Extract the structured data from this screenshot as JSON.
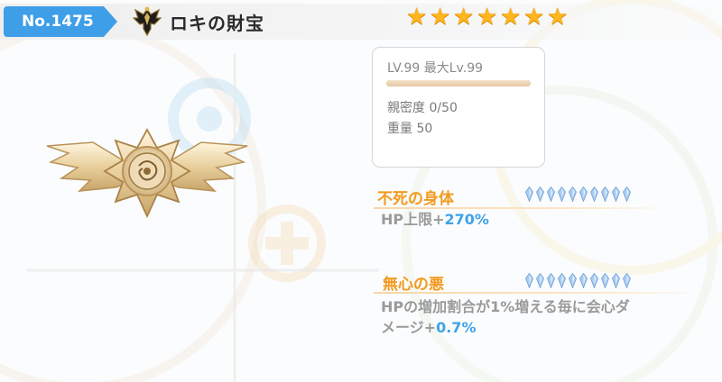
{
  "header": {
    "number": "No.1475",
    "title": "ロキの財宝",
    "stars": 7,
    "star_color": "#ffb51c",
    "tab_color": "#3f9ee8"
  },
  "stats": {
    "level_text": "LV.99 最大Lv.99",
    "level_progress": 1.0,
    "affinity_text": "親密度 0/50",
    "weight_text": "重量 50"
  },
  "skills": [
    {
      "name": "不死の身体",
      "crystals": 10,
      "desc_prefix": "HP上限+",
      "desc_value": "270%"
    },
    {
      "name": "無心の悪",
      "crystals": 10,
      "desc_line1": "HPの増加割合が1%増える毎に会心ダ",
      "desc_prefix2": "メージ+",
      "desc_value": "0.7%"
    }
  ],
  "colors": {
    "skill_name": "#f29a1e",
    "highlight_value": "#3fa3e8",
    "desc_text": "#9a9a9a"
  },
  "icons": {
    "title": "winged-emblem-icon",
    "item": "winged-medal-icon",
    "star": "star-icon",
    "crystal": "crystal-icon"
  }
}
